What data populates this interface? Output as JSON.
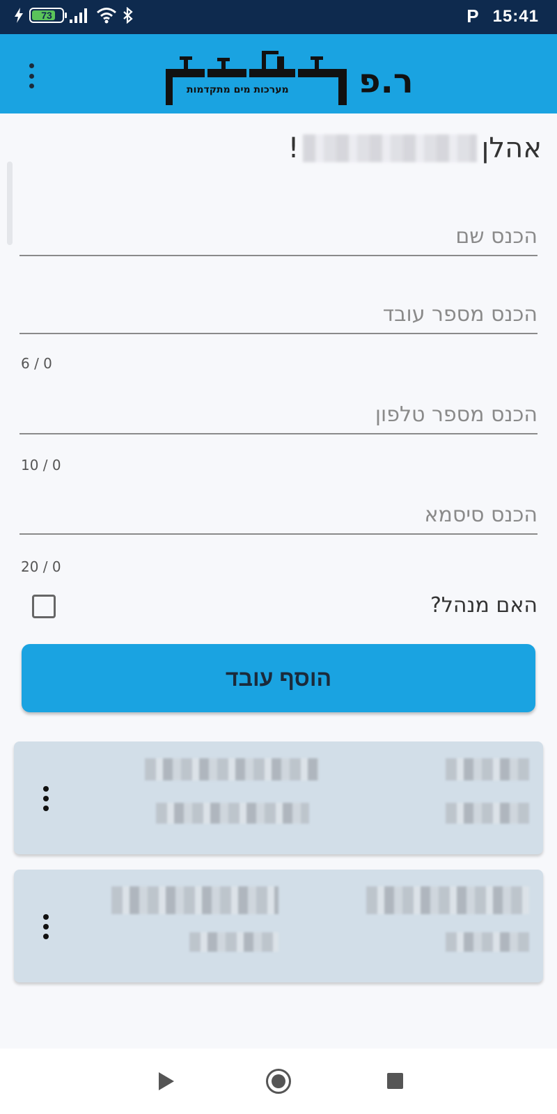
{
  "status_bar": {
    "battery": "73",
    "parking_icon": "P",
    "time": "15:41",
    "icons": [
      "charging-bolt-icon",
      "battery-icon",
      "signal-icon",
      "wifi-icon",
      "bluetooth-icon",
      "parking-icon"
    ]
  },
  "app_bar": {
    "logo_main": "ר.פ",
    "logo_sub": "מערכות מים מתקדמות",
    "menu_icon": "more-vert-icon"
  },
  "greeting": {
    "prefix": "אהלן",
    "suffix": "!"
  },
  "form": {
    "name_placeholder": "הכנס שם",
    "employee_number_placeholder": "הכנס מספר עובד",
    "employee_number_counter": "6 / 0",
    "phone_placeholder": "הכנס מספר טלפון",
    "phone_counter": "10 / 0",
    "password_placeholder": "הכנס סיסמא",
    "password_counter": "20 / 0",
    "is_manager_label": "האם מנהל?",
    "is_manager_checked": false,
    "add_button_label": "הוסף עובד"
  },
  "employee_cards": [
    {
      "menu_icon": "more-vert-icon"
    },
    {
      "menu_icon": "more-vert-icon"
    }
  ],
  "nav_bar": {
    "icons": [
      "back-icon",
      "home-icon",
      "recents-icon"
    ]
  },
  "colors": {
    "status_bar": "#0e2a4e",
    "accent": "#1aa3e1",
    "card": "#d2dee8",
    "background": "#f7f8fb"
  }
}
